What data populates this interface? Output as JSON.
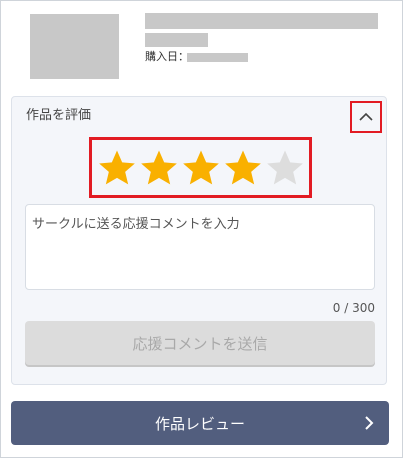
{
  "product": {
    "purchase_date_label": "購入日："
  },
  "rating": {
    "section_title": "作品を評価",
    "value": 4,
    "max": 5,
    "filled_color": "#f9b000",
    "empty_color": "#dddddd"
  },
  "comment": {
    "placeholder": "サークルに送る応援コメントを入力",
    "value": "",
    "char_count": "0 / 300"
  },
  "buttons": {
    "send_label": "応援コメントを送信",
    "review_label": "作品レビュー"
  },
  "icons": {
    "collapse": "chevron-up-icon",
    "review_arrow": "chevron-right-icon",
    "star": "star-icon"
  },
  "colors": {
    "highlight_border": "#e21b23",
    "review_button_bg": "#525e7e"
  }
}
